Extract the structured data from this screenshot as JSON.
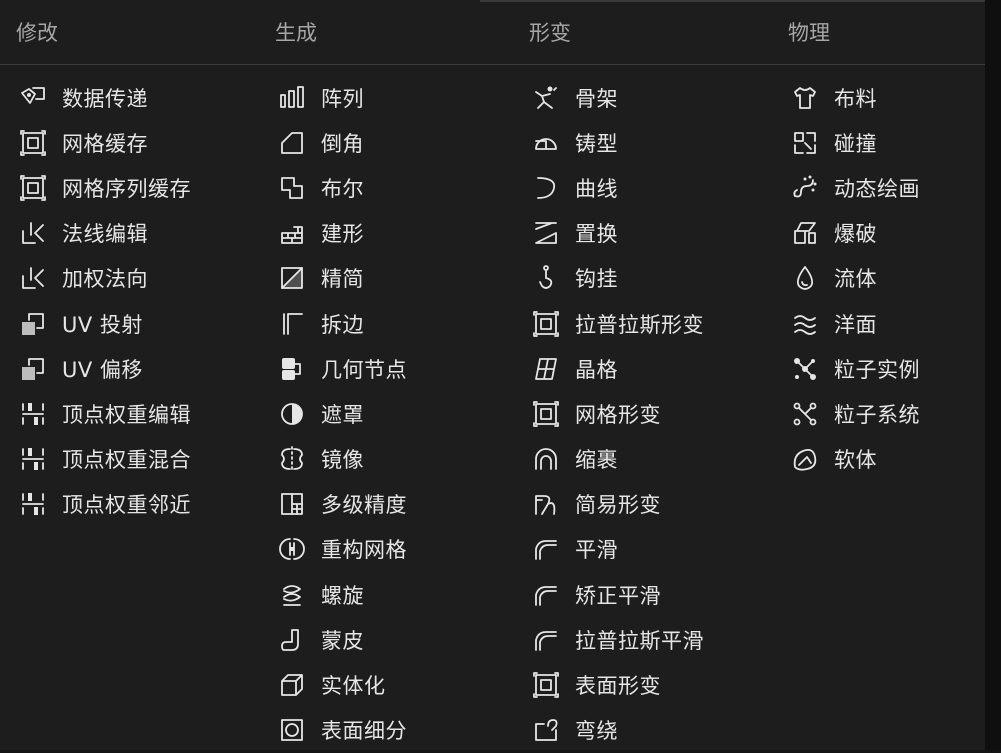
{
  "columns": [
    {
      "title": "修改",
      "items": [
        {
          "label": "数据传递",
          "icon": "data-transfer-icon"
        },
        {
          "label": "网格缓存",
          "icon": "mesh-cache-icon"
        },
        {
          "label": "网格序列缓存",
          "icon": "mesh-sequence-cache-icon"
        },
        {
          "label": "法线编辑",
          "icon": "normal-edit-icon"
        },
        {
          "label": "加权法向",
          "icon": "weighted-normal-icon"
        },
        {
          "label": "UV 投射",
          "icon": "uv-project-icon"
        },
        {
          "label": "UV 偏移",
          "icon": "uv-warp-icon"
        },
        {
          "label": "顶点权重编辑",
          "icon": "vertex-weight-edit-icon"
        },
        {
          "label": "顶点权重混合",
          "icon": "vertex-weight-mix-icon"
        },
        {
          "label": "顶点权重邻近",
          "icon": "vertex-weight-proximity-icon"
        }
      ]
    },
    {
      "title": "生成",
      "items": [
        {
          "label": "阵列",
          "icon": "array-icon"
        },
        {
          "label": "倒角",
          "icon": "bevel-icon"
        },
        {
          "label": "布尔",
          "icon": "boolean-icon"
        },
        {
          "label": "建形",
          "icon": "build-icon"
        },
        {
          "label": "精简",
          "icon": "decimate-icon"
        },
        {
          "label": "拆边",
          "icon": "edge-split-icon"
        },
        {
          "label": "几何节点",
          "icon": "geometry-nodes-icon"
        },
        {
          "label": "遮罩",
          "icon": "mask-icon"
        },
        {
          "label": "镜像",
          "icon": "mirror-icon"
        },
        {
          "label": "多级精度",
          "icon": "multires-icon"
        },
        {
          "label": "重构网格",
          "icon": "remesh-icon"
        },
        {
          "label": "螺旋",
          "icon": "screw-icon"
        },
        {
          "label": "蒙皮",
          "icon": "skin-icon"
        },
        {
          "label": "实体化",
          "icon": "solidify-icon"
        },
        {
          "label": "表面细分",
          "icon": "subdivision-icon"
        }
      ]
    },
    {
      "title": "形变",
      "items": [
        {
          "label": "骨架",
          "icon": "armature-icon"
        },
        {
          "label": "铸型",
          "icon": "cast-icon"
        },
        {
          "label": "曲线",
          "icon": "curve-icon"
        },
        {
          "label": "置换",
          "icon": "displace-icon"
        },
        {
          "label": "钩挂",
          "icon": "hook-icon"
        },
        {
          "label": "拉普拉斯形变",
          "icon": "laplacian-deform-icon"
        },
        {
          "label": "晶格",
          "icon": "lattice-icon"
        },
        {
          "label": "网格形变",
          "icon": "mesh-deform-icon"
        },
        {
          "label": "缩裹",
          "icon": "shrinkwrap-icon"
        },
        {
          "label": "简易形变",
          "icon": "simple-deform-icon"
        },
        {
          "label": "平滑",
          "icon": "smooth-icon"
        },
        {
          "label": "矫正平滑",
          "icon": "corrective-smooth-icon"
        },
        {
          "label": "拉普拉斯平滑",
          "icon": "laplacian-smooth-icon"
        },
        {
          "label": "表面形变",
          "icon": "surface-deform-icon"
        },
        {
          "label": "弯绕",
          "icon": "warp-icon"
        }
      ]
    },
    {
      "title": "物理",
      "items": [
        {
          "label": "布料",
          "icon": "cloth-icon"
        },
        {
          "label": "碰撞",
          "icon": "collision-icon"
        },
        {
          "label": "动态绘画",
          "icon": "dynamic-paint-icon"
        },
        {
          "label": "爆破",
          "icon": "explode-icon"
        },
        {
          "label": "流体",
          "icon": "fluid-icon"
        },
        {
          "label": "洋面",
          "icon": "ocean-icon"
        },
        {
          "label": "粒子实例",
          "icon": "particle-instance-icon"
        },
        {
          "label": "粒子系统",
          "icon": "particle-system-icon"
        },
        {
          "label": "软体",
          "icon": "soft-body-icon"
        }
      ]
    }
  ]
}
